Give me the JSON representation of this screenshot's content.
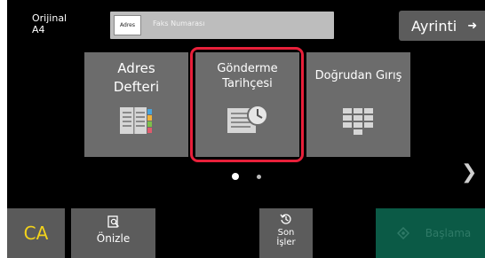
{
  "original": {
    "label": "Orijinal",
    "size": "A4"
  },
  "address_bar": {
    "button_label": "Adres",
    "placeholder": "Faks Numarası"
  },
  "detail_button": {
    "label": "Ayrinti",
    "arrow": "➜"
  },
  "tiles": [
    {
      "label_line1": "Adres",
      "label_line2": "Defteri",
      "icon": "address-book-icon"
    },
    {
      "label_line1": "Gönderme",
      "label_line2": "Tarihçesi",
      "icon": "send-history-icon",
      "selected": true
    },
    {
      "label_line1": "Doğrudan Gırış",
      "label_line2": "",
      "icon": "keypad-icon"
    }
  ],
  "pagination": {
    "pages": 2,
    "current": 1
  },
  "next_icon": "chevron-right-icon",
  "bottom": {
    "ca_label": "CA",
    "preview_label": "Önizle",
    "history_label_line1": "Son",
    "history_label_line2": "İşler",
    "start_label": "Başlama"
  },
  "colors": {
    "background": "#000000",
    "tile": "#6c6c6c",
    "selection_frame": "#e8203a",
    "ca_text": "#f2d21b",
    "start_button": "#0b5a46"
  }
}
